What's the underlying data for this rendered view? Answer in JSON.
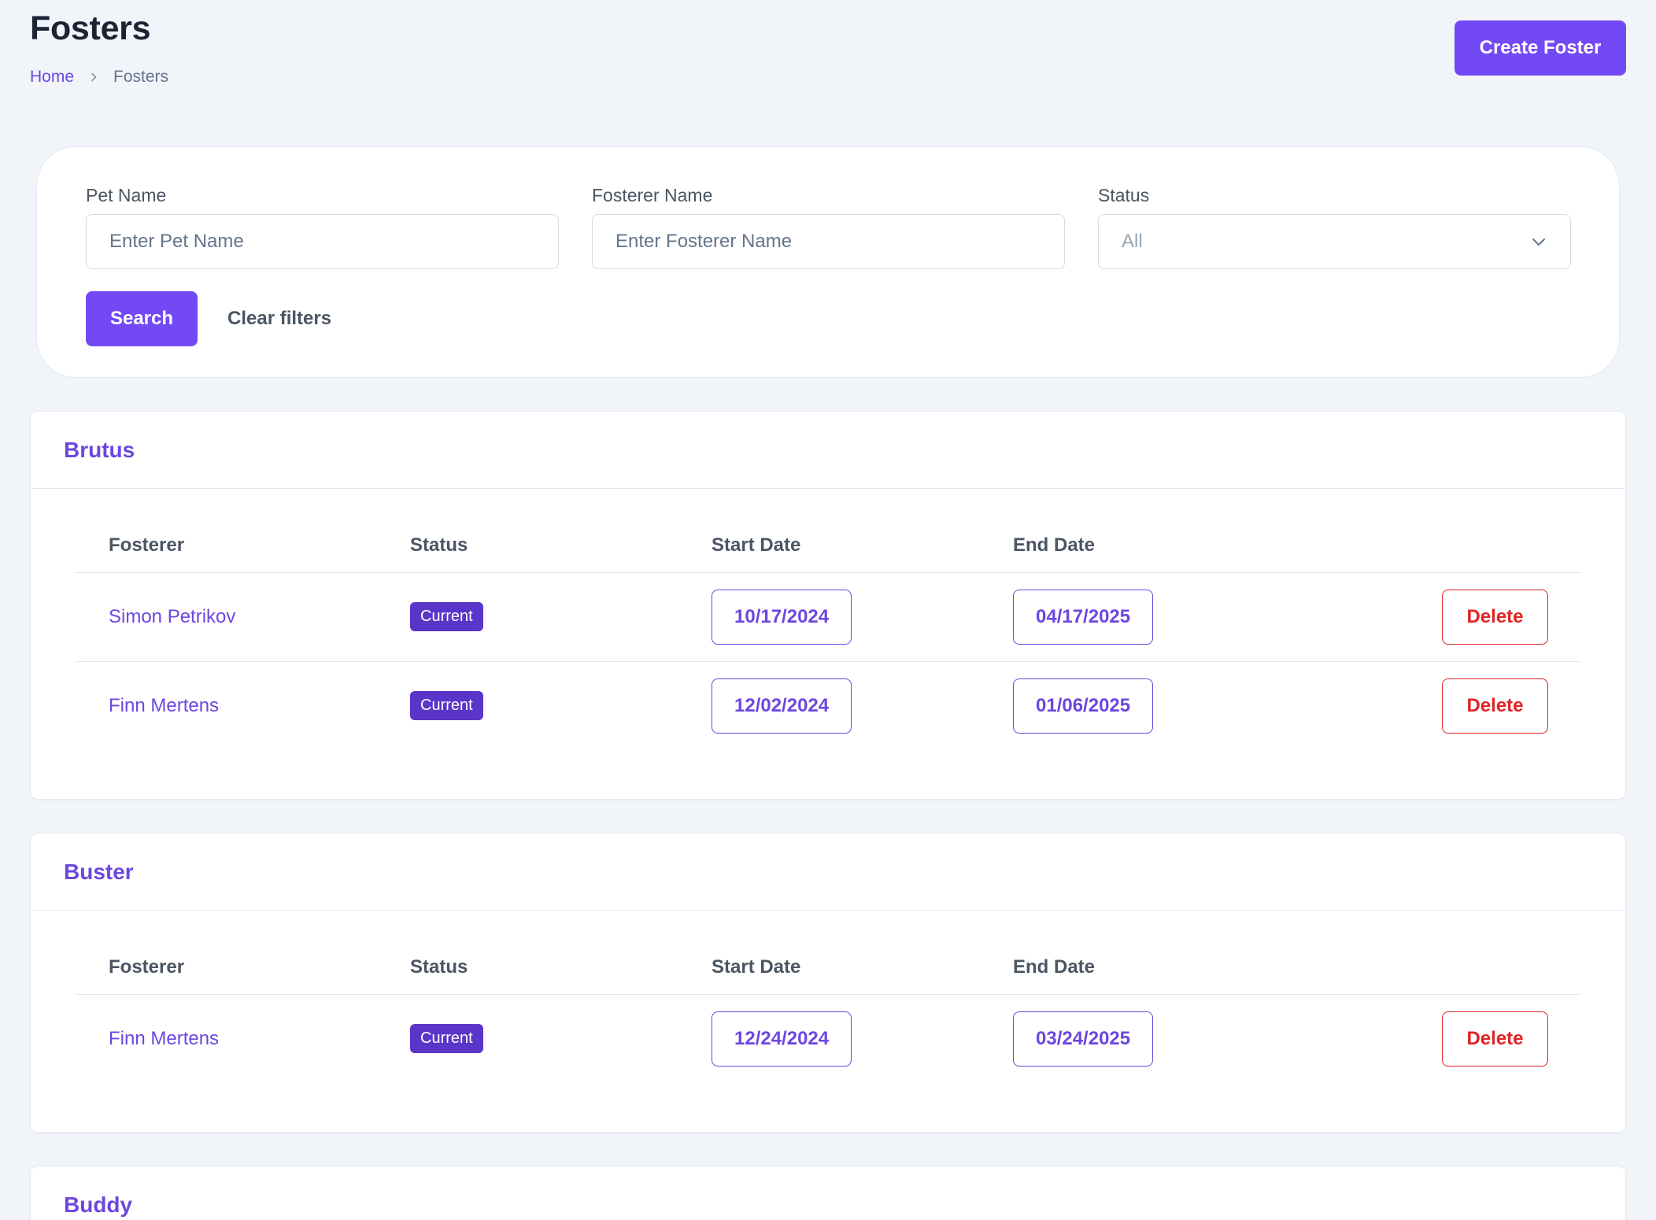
{
  "header": {
    "title": "Fosters",
    "breadcrumb": {
      "home": "Home",
      "current": "Fosters"
    },
    "create_label": "Create Foster"
  },
  "filters": {
    "pet_name": {
      "label": "Pet Name",
      "placeholder": "Enter Pet Name",
      "value": ""
    },
    "fosterer_name": {
      "label": "Fosterer Name",
      "placeholder": "Enter Fosterer Name",
      "value": ""
    },
    "status": {
      "label": "Status",
      "value": "All"
    },
    "search_label": "Search",
    "clear_label": "Clear filters"
  },
  "table_headers": {
    "fosterer": "Fosterer",
    "status": "Status",
    "start": "Start Date",
    "end": "End Date"
  },
  "pets": [
    {
      "name": "Brutus",
      "rows": [
        {
          "fosterer": "Simon Petrikov",
          "status": "Current",
          "start": "10/17/2024",
          "end": "04/17/2025",
          "delete": "Delete"
        },
        {
          "fosterer": "Finn Mertens",
          "status": "Current",
          "start": "12/02/2024",
          "end": "01/06/2025",
          "delete": "Delete"
        }
      ]
    },
    {
      "name": "Buster",
      "rows": [
        {
          "fosterer": "Finn Mertens",
          "status": "Current",
          "start": "12/24/2024",
          "end": "03/24/2025",
          "delete": "Delete"
        }
      ]
    },
    {
      "name": "Buddy",
      "rows": []
    }
  ],
  "colors": {
    "accent": "#7349f6",
    "link": "#6c47e0",
    "badge": "#5b34c9",
    "danger": "#e02424",
    "background": "#f1f4f9"
  }
}
